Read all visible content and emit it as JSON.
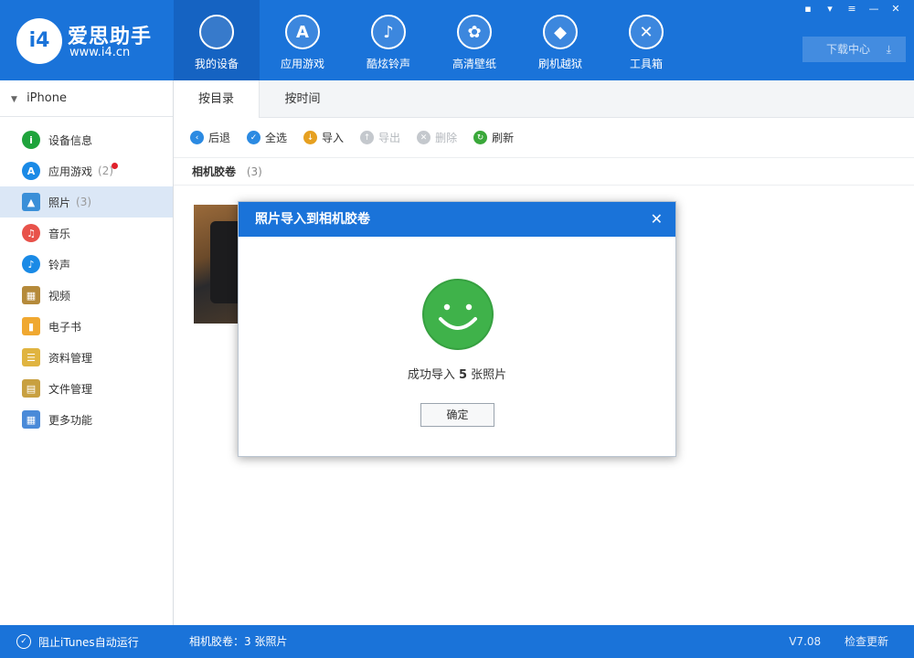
{
  "app": {
    "logo_mark": "i4",
    "title": "爱思助手",
    "url": "www.i4.cn"
  },
  "nav": [
    {
      "label": "我的设备",
      "icon": "apple-icon",
      "glyph": "",
      "active": true
    },
    {
      "label": "应用游戏",
      "icon": "app-store-icon",
      "glyph": "A",
      "active": false
    },
    {
      "label": "酷炫铃声",
      "icon": "bell-icon",
      "glyph": "♪",
      "active": false
    },
    {
      "label": "高清壁纸",
      "icon": "flower-icon",
      "glyph": "✿",
      "active": false
    },
    {
      "label": "刷机越狱",
      "icon": "dropbox-icon",
      "glyph": "◆",
      "active": false
    },
    {
      "label": "工具箱",
      "icon": "tools-icon",
      "glyph": "✕",
      "active": false
    }
  ],
  "download": {
    "label": "下载中心",
    "icon": "download-icon"
  },
  "device": {
    "name": "iPhone"
  },
  "sidebar": [
    {
      "label": "设备信息",
      "count": "",
      "icon": "info-icon",
      "glyph": "i",
      "color": "#1fa33c",
      "badge": false,
      "active": false,
      "square": false
    },
    {
      "label": "应用游戏",
      "count": "(2)",
      "icon": "app-store-icon",
      "glyph": "A",
      "color": "#1a8ae6",
      "badge": true,
      "active": false,
      "square": false
    },
    {
      "label": "照片",
      "count": "(3)",
      "icon": "photo-icon",
      "glyph": "▲",
      "color": "#3a8fd8",
      "badge": false,
      "active": true,
      "square": true
    },
    {
      "label": "音乐",
      "count": "",
      "icon": "music-icon",
      "glyph": "♫",
      "color": "#e8524a",
      "badge": false,
      "active": false,
      "square": false
    },
    {
      "label": "铃声",
      "count": "",
      "icon": "bell-icon",
      "glyph": "♪",
      "color": "#1a8ae6",
      "badge": false,
      "active": false,
      "square": false
    },
    {
      "label": "视频",
      "count": "",
      "icon": "film-icon",
      "glyph": "▦",
      "color": "#b58a3a",
      "badge": false,
      "active": false,
      "square": true
    },
    {
      "label": "电子书",
      "count": "",
      "icon": "book-icon",
      "glyph": "▮",
      "color": "#f0a830",
      "badge": false,
      "active": false,
      "square": true
    },
    {
      "label": "资料管理",
      "count": "",
      "icon": "contacts-icon",
      "glyph": "☰",
      "color": "#e0b440",
      "badge": false,
      "active": false,
      "square": true
    },
    {
      "label": "文件管理",
      "count": "",
      "icon": "file-icon",
      "glyph": "▤",
      "color": "#c8a040",
      "badge": false,
      "active": false,
      "square": true
    },
    {
      "label": "更多功能",
      "count": "",
      "icon": "grid-icon",
      "glyph": "▦",
      "color": "#4a8ad8",
      "badge": false,
      "active": false,
      "square": true
    }
  ],
  "tabs": [
    {
      "label": "按目录",
      "active": true
    },
    {
      "label": "按时间",
      "active": false
    }
  ],
  "toolbar": [
    {
      "label": "后退",
      "icon": "back-icon",
      "glyph": "‹",
      "color": "#2b8ae2",
      "disabled": false
    },
    {
      "label": "全选",
      "icon": "check-icon",
      "glyph": "✓",
      "color": "#2b8ae2",
      "disabled": false
    },
    {
      "label": "导入",
      "icon": "import-icon",
      "glyph": "↓",
      "color": "#e6a020",
      "disabled": false
    },
    {
      "label": "导出",
      "icon": "export-icon",
      "glyph": "↑",
      "color": "#c4c8cd",
      "disabled": true
    },
    {
      "label": "删除",
      "icon": "delete-icon",
      "glyph": "✕",
      "color": "#c4c8cd",
      "disabled": true
    },
    {
      "label": "刷新",
      "icon": "refresh-icon",
      "glyph": "↻",
      "color": "#3aa83a",
      "disabled": false
    }
  ],
  "album": {
    "name": "相机胶卷",
    "count": "(3)"
  },
  "modal": {
    "title": "照片导入到相机胶卷",
    "msg_prefix": "成功导入",
    "msg_count": "5",
    "msg_suffix": "张照片",
    "ok_label": "确定",
    "close_glyph": "✕"
  },
  "status": {
    "itunes_label": "阻止iTunes自动运行",
    "album_summary": "相机胶卷：3 张照片",
    "version": "V7.08",
    "update_label": "检查更新"
  },
  "colors": {
    "accent": "#1a73d9",
    "success_green": "#3fb24a"
  }
}
